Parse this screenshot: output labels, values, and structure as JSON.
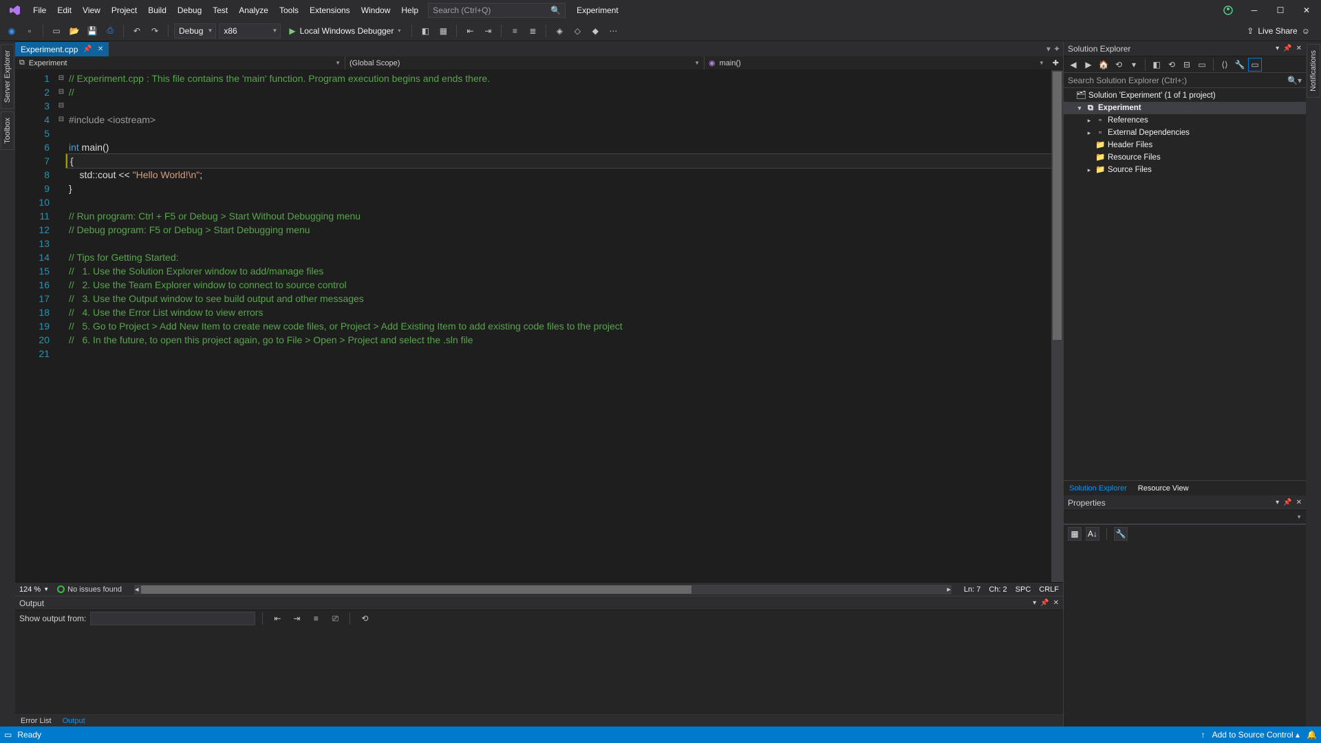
{
  "menubar": {
    "items": [
      "File",
      "Edit",
      "View",
      "Project",
      "Build",
      "Debug",
      "Test",
      "Analyze",
      "Tools",
      "Extensions",
      "Window",
      "Help"
    ],
    "search_placeholder": "Search (Ctrl+Q)",
    "project_name": "Experiment"
  },
  "toolbar": {
    "config": "Debug",
    "platform": "x86",
    "debug_target": "Local Windows Debugger",
    "live_share": "Live Share"
  },
  "tabs": {
    "active": "Experiment.cpp"
  },
  "navbar": {
    "scope_left": "Experiment",
    "scope_mid": "(Global Scope)",
    "scope_right": "main()"
  },
  "code": {
    "lines": [
      {
        "n": 1,
        "fold": "⊟",
        "seg": [
          {
            "c": "c-comment",
            "t": "// Experiment.cpp : This file contains the 'main' function. Program execution begins and ends there."
          }
        ]
      },
      {
        "n": 2,
        "seg": [
          {
            "c": "c-comment",
            "t": "//"
          }
        ]
      },
      {
        "n": 3,
        "seg": []
      },
      {
        "n": 4,
        "seg": [
          {
            "c": "c-pp",
            "t": "#include "
          },
          {
            "c": "c-pp",
            "t": "<iostream>"
          }
        ]
      },
      {
        "n": 5,
        "seg": []
      },
      {
        "n": 6,
        "fold": "⊟",
        "seg": [
          {
            "c": "c-kw",
            "t": "int"
          },
          {
            "c": "",
            "t": " main()"
          }
        ]
      },
      {
        "n": 7,
        "hl": true,
        "seg": [
          {
            "c": "",
            "t": "{"
          }
        ]
      },
      {
        "n": 8,
        "seg": [
          {
            "c": "",
            "t": "    std::cout << "
          },
          {
            "c": "c-str",
            "t": "\"Hello World!\\n\""
          },
          {
            "c": "",
            "t": ";"
          }
        ]
      },
      {
        "n": 9,
        "seg": [
          {
            "c": "",
            "t": "}"
          }
        ]
      },
      {
        "n": 10,
        "seg": []
      },
      {
        "n": 11,
        "fold": "⊟",
        "seg": [
          {
            "c": "c-comment",
            "t": "// Run program: Ctrl + F5 or Debug > Start Without Debugging menu"
          }
        ]
      },
      {
        "n": 12,
        "seg": [
          {
            "c": "c-comment",
            "t": "// Debug program: F5 or Debug > Start Debugging menu"
          }
        ]
      },
      {
        "n": 13,
        "seg": []
      },
      {
        "n": 14,
        "fold": "⊟",
        "seg": [
          {
            "c": "c-comment",
            "t": "// Tips for Getting Started: "
          }
        ]
      },
      {
        "n": 15,
        "seg": [
          {
            "c": "c-comment",
            "t": "//   1. Use the Solution Explorer window to add/manage files"
          }
        ]
      },
      {
        "n": 16,
        "seg": [
          {
            "c": "c-comment",
            "t": "//   2. Use the Team Explorer window to connect to source control"
          }
        ]
      },
      {
        "n": 17,
        "seg": [
          {
            "c": "c-comment",
            "t": "//   3. Use the Output window to see build output and other messages"
          }
        ]
      },
      {
        "n": 18,
        "seg": [
          {
            "c": "c-comment",
            "t": "//   4. Use the Error List window to view errors"
          }
        ]
      },
      {
        "n": 19,
        "seg": [
          {
            "c": "c-comment",
            "t": "//   5. Go to Project > Add New Item to create new code files, or Project > Add Existing Item to add existing code files to the project"
          }
        ]
      },
      {
        "n": 20,
        "seg": [
          {
            "c": "c-comment",
            "t": "//   6. In the future, to open this project again, go to File > Open > Project and select the .sln file"
          }
        ]
      },
      {
        "n": 21,
        "seg": []
      }
    ]
  },
  "editor_status": {
    "zoom": "124 %",
    "issues": "No issues found",
    "ln": "Ln: 7",
    "col": "Ch: 2",
    "enc": "SPC",
    "eol": "CRLF"
  },
  "output": {
    "panel_title": "Output",
    "show_from_label": "Show output from:"
  },
  "bottom_tabs": {
    "error_list": "Error List",
    "output": "Output"
  },
  "left_tabs": [
    "Server Explorer",
    "Toolbox"
  ],
  "right_tabs": [
    "Notifications"
  ],
  "solution_explorer": {
    "title": "Solution Explorer",
    "search_placeholder": "Search Solution Explorer (Ctrl+;)",
    "nodes": [
      {
        "depth": 0,
        "exp": "",
        "icon": "🗂",
        "label": "Solution 'Experiment' (1 of 1 project)"
      },
      {
        "depth": 1,
        "exp": "▾",
        "icon": "⧉",
        "label": "Experiment",
        "bold": true,
        "sel": true
      },
      {
        "depth": 2,
        "exp": "▸",
        "icon": "▫",
        "label": "References"
      },
      {
        "depth": 2,
        "exp": "▸",
        "icon": "▫",
        "label": "External Dependencies"
      },
      {
        "depth": 2,
        "exp": "",
        "icon": "📁",
        "label": "Header Files"
      },
      {
        "depth": 2,
        "exp": "",
        "icon": "📁",
        "label": "Resource Files"
      },
      {
        "depth": 2,
        "exp": "▸",
        "icon": "📁",
        "label": "Source Files"
      }
    ],
    "tabs": {
      "se": "Solution Explorer",
      "rv": "Resource View"
    }
  },
  "properties": {
    "title": "Properties"
  },
  "statusbar": {
    "ready": "Ready",
    "add_sc": "Add to Source Control"
  }
}
